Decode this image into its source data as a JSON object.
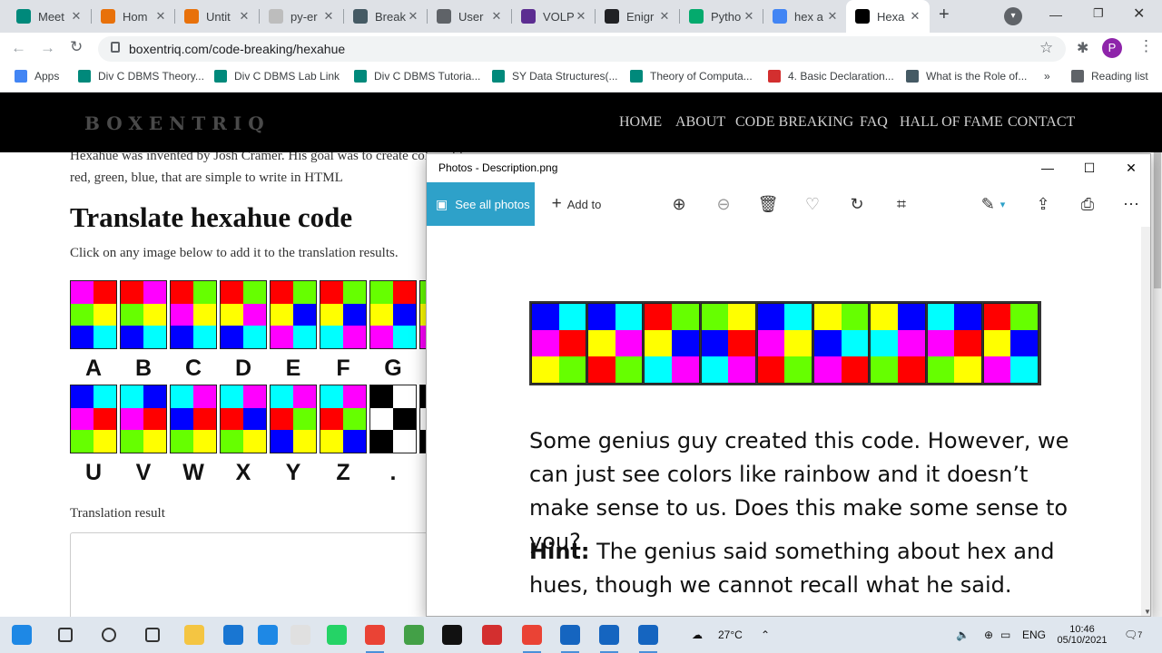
{
  "browser": {
    "tabs": [
      {
        "title": "Meet",
        "fav": "meet",
        "color": "#00897b"
      },
      {
        "title": "Hom",
        "fav": "home",
        "color": "#e8710a"
      },
      {
        "title": "Untit",
        "fav": "doc",
        "color": "#e8710a"
      },
      {
        "title": "py-er",
        "fav": "file",
        "color": "#bdbdbd"
      },
      {
        "title": "Break",
        "fav": "tds",
        "color": "#455a64"
      },
      {
        "title": "User",
        "fav": "user",
        "color": "#5f6368"
      },
      {
        "title": "VOLP",
        "fav": "volp",
        "color": "#5c2d91"
      },
      {
        "title": "Enigr",
        "fav": "wiki",
        "color": "#202124"
      },
      {
        "title": "Pytho",
        "fav": "w3",
        "color": "#04aa6d"
      },
      {
        "title": "hex a",
        "fav": "google",
        "color": "#4285f4"
      },
      {
        "title": "Hexa",
        "fav": "boxentriq",
        "color": "#000000"
      }
    ],
    "address": "boxentriq.com/code-breaking/hexahue",
    "profile_initial": "P",
    "bookmarks": [
      "Apps",
      "Div C DBMS Theory...",
      "Div C DBMS Lab Link",
      "Div C DBMS Tutoria...",
      "SY Data Structures(...",
      "Theory of Computa...",
      "4. Basic Declaration...",
      "What is the Role of...",
      "Reading list"
    ],
    "more_bookmarks": "»"
  },
  "site": {
    "logo": "BOXENTRIQ",
    "nav": [
      "HOME",
      "ABOUT",
      "CODE BREAKING",
      "FAQ",
      "HALL OF FAME",
      "CONTACT"
    ],
    "intro": "Hexahue was invented by Josh Cramer. His goal was to create colors, like red, green, blue, that are simple to write in HTML",
    "title": "Translate hexahue code",
    "hint": "Click on any image below to add it to the translation results.",
    "row1_letters": [
      "A",
      "B",
      "C",
      "D",
      "E",
      "F",
      "G"
    ],
    "row2_letters": [
      "U",
      "V",
      "W",
      "X",
      "Y",
      "Z",
      "."
    ],
    "result_label": "Translation result"
  },
  "photos": {
    "window_title": "Photos - Description.png",
    "see_all": "See all photos",
    "add_to": "Add to",
    "description": "Some genius guy created this code. However, we can just see colors like rainbow and it doesn’t make sense to us. Does this make some sense to you?",
    "hint_label": "Hint:",
    "hint_text": " The genius said something about hex and hues, though we cannot recall what he said."
  },
  "hexahue_colors": {
    "M": "#ff00ff",
    "R": "#ff0000",
    "G": "#66ff00",
    "Y": "#ffff00",
    "B": "#0000ff",
    "C": "#00ffff",
    "K": "#000000",
    "W": "#ffffff"
  },
  "taskbar": {
    "weather": "27°C",
    "lang": "ENG",
    "time": "10:46",
    "date": "05/10/2021",
    "notifications": "7"
  }
}
